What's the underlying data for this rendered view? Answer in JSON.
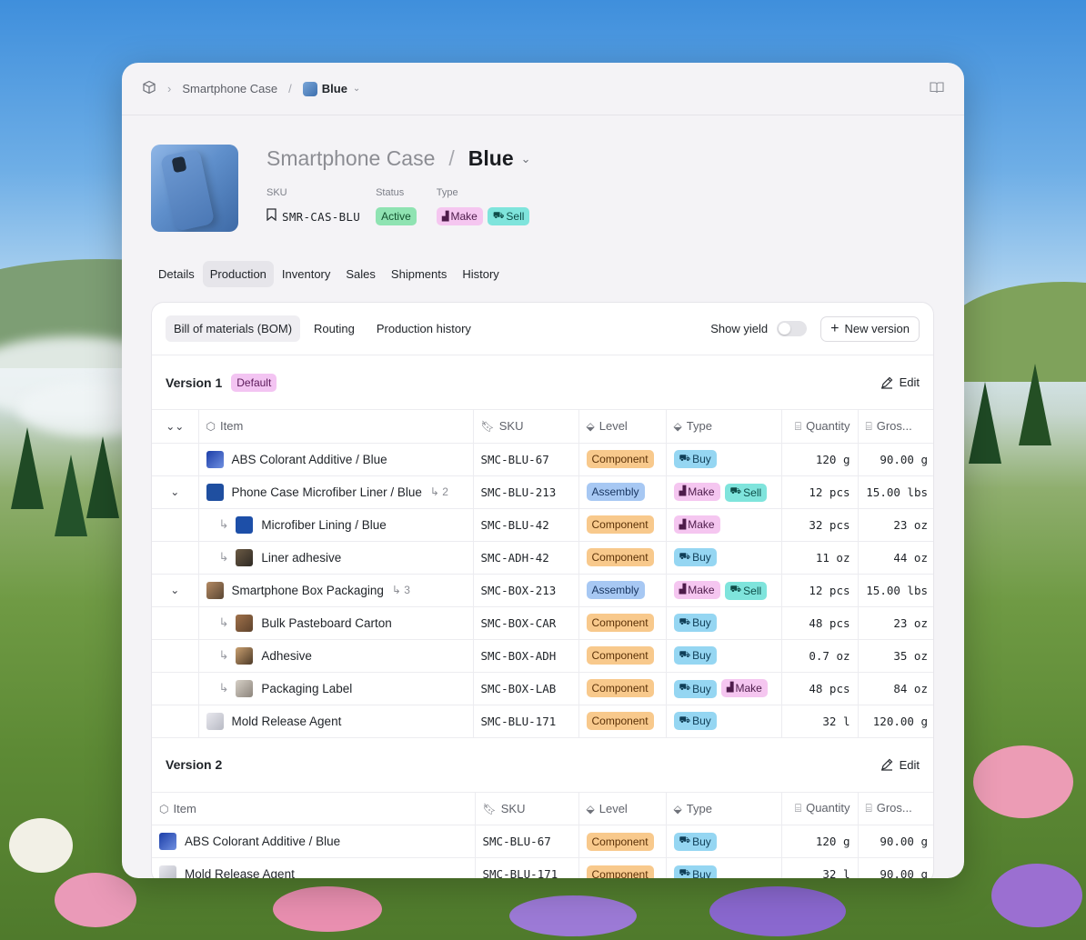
{
  "breadcrumb": {
    "parent": "Smartphone Case",
    "current": "Blue"
  },
  "product": {
    "parent": "Smartphone Case",
    "variant": "Blue",
    "sku_label": "SKU",
    "sku": "SMR-CAS-BLU",
    "status_label": "Status",
    "status": "Active",
    "type_label": "Type",
    "types": [
      "Make",
      "Sell"
    ]
  },
  "tabs": [
    "Details",
    "Production",
    "Inventory",
    "Sales",
    "Shipments",
    "History"
  ],
  "selected_tab": "Production",
  "subtabs": [
    "Bill of materials (BOM)",
    "Routing",
    "Production history"
  ],
  "show_yield_label": "Show yield",
  "new_version_label": "New version",
  "columns": {
    "item": "Item",
    "sku": "SKU",
    "level": "Level",
    "type": "Type",
    "quantity": "Quantity",
    "gross": "Gros..."
  },
  "version1": {
    "title": "Version 1",
    "badge": "Default",
    "edit_label": "Edit",
    "rows": [
      {
        "item": "ABS Colorant Additive / Blue",
        "sku": "SMC-BLU-67",
        "level": "Component",
        "types": [
          "Buy"
        ],
        "qty": "120 g",
        "gross": "90.00 g",
        "child": false,
        "expand": false,
        "count": ""
      },
      {
        "item": "Phone Case Microfiber Liner / Blue",
        "sku": "SMC-BLU-213",
        "level": "Assembly",
        "types": [
          "Make",
          "Sell"
        ],
        "qty": "12 pcs",
        "gross": "15.00 lbs",
        "child": false,
        "expand": true,
        "count": "2"
      },
      {
        "item": "Microfiber Lining / Blue",
        "sku": "SMC-BLU-42",
        "level": "Component",
        "types": [
          "Make"
        ],
        "qty": "32 pcs",
        "gross": "23 oz",
        "child": true,
        "expand": false,
        "count": ""
      },
      {
        "item": "Liner adhesive",
        "sku": "SMC-ADH-42",
        "level": "Component",
        "types": [
          "Buy"
        ],
        "qty": "11 oz",
        "gross": "44 oz",
        "child": true,
        "expand": false,
        "count": ""
      },
      {
        "item": "Smartphone Box Packaging",
        "sku": "SMC-BOX-213",
        "level": "Assembly",
        "types": [
          "Make",
          "Sell"
        ],
        "qty": "12 pcs",
        "gross": "15.00 lbs",
        "child": false,
        "expand": true,
        "count": "3"
      },
      {
        "item": "Bulk Pasteboard Carton",
        "sku": "SMC-BOX-CAR",
        "level": "Component",
        "types": [
          "Buy"
        ],
        "qty": "48 pcs",
        "gross": "23 oz",
        "child": true,
        "expand": false,
        "count": ""
      },
      {
        "item": "Adhesive",
        "sku": "SMC-BOX-ADH",
        "level": "Component",
        "types": [
          "Buy"
        ],
        "qty": "0.7 oz",
        "gross": "35 oz",
        "child": true,
        "expand": false,
        "count": ""
      },
      {
        "item": "Packaging Label",
        "sku": "SMC-BOX-LAB",
        "level": "Component",
        "types": [
          "Buy",
          "Make"
        ],
        "qty": "48 pcs",
        "gross": "84 oz",
        "child": true,
        "expand": false,
        "count": ""
      },
      {
        "item": "Mold Release Agent",
        "sku": "SMC-BLU-171",
        "level": "Component",
        "types": [
          "Buy"
        ],
        "qty": "32 l",
        "gross": "120.00 g",
        "child": false,
        "expand": false,
        "count": ""
      }
    ]
  },
  "version2": {
    "title": "Version 2",
    "edit_label": "Edit",
    "rows": [
      {
        "item": "ABS Colorant Additive / Blue",
        "sku": "SMC-BLU-67",
        "level": "Component",
        "types": [
          "Buy"
        ],
        "qty": "120 g",
        "gross": "90.00 g"
      },
      {
        "item": "Mold Release Agent",
        "sku": "SMC-BLU-171",
        "level": "Component",
        "types": [
          "Buy"
        ],
        "qty": "32 l",
        "gross": "90.00 g"
      }
    ]
  },
  "colors": {
    "active": "#8fe3b2",
    "make": "#f5c6f0",
    "sell": "#7fe4dc",
    "buy": "#95d6f2",
    "component": "#f8c98c",
    "assembly": "#a7c8f3"
  }
}
